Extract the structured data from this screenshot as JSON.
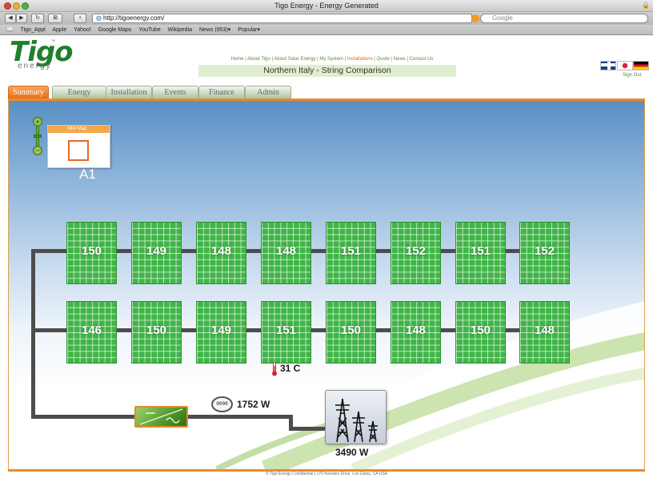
{
  "browser": {
    "window_title": "Tigo Energy - Energy Generated",
    "url": "http://tigoenergy.com/",
    "search_placeholder": "Google",
    "bookmarks": [
      "Tigo_Appl",
      "Apple",
      "Yahoo!",
      "Google Maps",
      "YouTube",
      "Wikipedia",
      "News (953)▾",
      "Popular▾"
    ]
  },
  "header": {
    "logo_main": "Tigo",
    "logo_sub": "energy",
    "logo_tm": "™",
    "nav": [
      "Home",
      "About Tigo",
      "About Solar Energy",
      "My System",
      "Installations",
      "Quote",
      "News",
      "Contact Us"
    ],
    "nav_active": "Installations",
    "page_title": "Northern Italy - String Comparison",
    "sign_out": "Sign Out",
    "flags": [
      "uk-flag-icon",
      "japan-flag-icon",
      "germany-flag-icon"
    ]
  },
  "tabs": [
    "Summary",
    "Energy",
    "Installation",
    "Events",
    "Finance",
    "Admin"
  ],
  "tabs_active": "Summary",
  "minimap": {
    "label": "Mini Map"
  },
  "array": {
    "label": "A1",
    "string1": [
      "150",
      "149",
      "148",
      "148",
      "151",
      "152",
      "151",
      "152"
    ],
    "string2": [
      "146",
      "150",
      "149",
      "151",
      "150",
      "148",
      "150",
      "148"
    ]
  },
  "temperature": "31 C",
  "meter_label": "1752 W",
  "meter_digits": "0000",
  "grid_label": "3490 W",
  "footer": "© Tigo Energy Confidential | 170 Knowles Drive, Los Gatos, CA USA",
  "colors": {
    "accent": "#ec8a2b",
    "brand_green": "#1f7f2d",
    "panel_green": "#3fb547"
  }
}
